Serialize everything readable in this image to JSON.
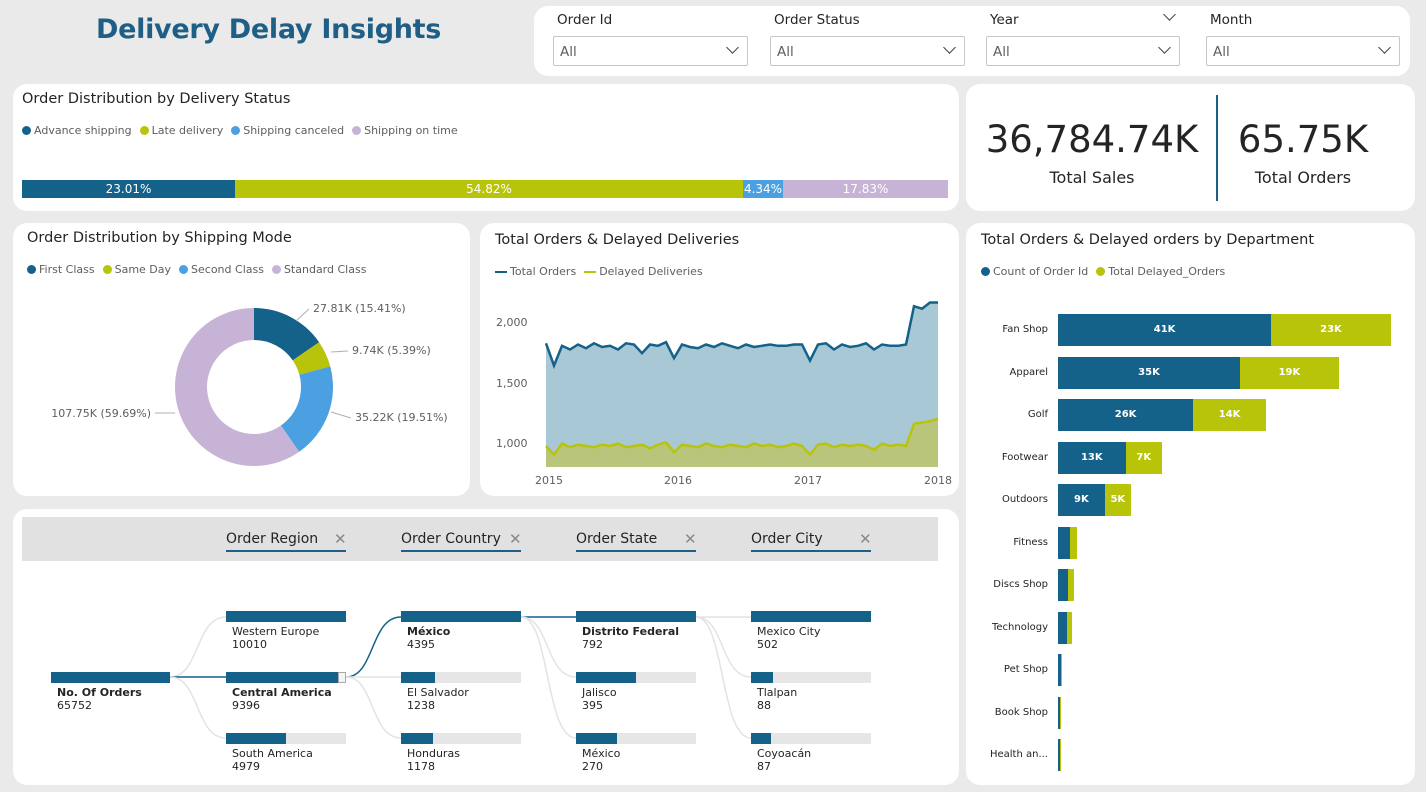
{
  "app": {
    "title": "Delivery Delay Insights"
  },
  "colors": {
    "navy": "#146189",
    "lime": "#b8c40a",
    "sky": "#4aa0e0",
    "lilac": "#c7b3d6",
    "area": "#a8c8d6",
    "area_lime": "#b8c57a"
  },
  "filters": [
    {
      "label": "Order Id",
      "value": "All"
    },
    {
      "label": "Order Status",
      "value": "All"
    },
    {
      "label": "Year",
      "value": "All"
    },
    {
      "label": "Month",
      "value": "All"
    }
  ],
  "delivery_status": {
    "title": "Order Distribution by Delivery Status",
    "legend": [
      "Advance shipping",
      "Late delivery",
      "Shipping canceled",
      "Shipping on time"
    ],
    "segments": [
      {
        "label": "23.01%",
        "value": 23.01
      },
      {
        "label": "54.82%",
        "value": 54.82
      },
      {
        "label": "4.34%",
        "value": 4.34
      },
      {
        "label": "17.83%",
        "value": 17.83
      }
    ]
  },
  "kpis": {
    "sales_value": "36,784.74K",
    "sales_label": "Total Sales",
    "orders_value": "65.75K",
    "orders_label": "Total Orders"
  },
  "shipping_mode": {
    "title": "Order Distribution by Shipping Mode",
    "legend": [
      "First Class",
      "Same Day",
      "Second Class",
      "Standard Class"
    ],
    "slices": [
      {
        "label": "27.81K (15.41%)",
        "value": 15.41
      },
      {
        "label": "9.74K (5.39%)",
        "value": 5.39
      },
      {
        "label": "35.22K (19.51%)",
        "value": 19.51
      },
      {
        "label": "107.75K (59.69%)",
        "value": 59.69
      }
    ]
  },
  "trend": {
    "title": "Total Orders & Delayed Deliveries",
    "legend": [
      "Total Orders",
      "Delayed Deliveries"
    ],
    "y_ticks": [
      "2,000",
      "1,500",
      "1,000"
    ],
    "x_ticks": [
      "2015",
      "2016",
      "2017",
      "2018"
    ]
  },
  "department": {
    "title": "Total Orders & Delayed orders by Department",
    "legend": [
      "Count of Order Id",
      "Total Delayed_Orders"
    ],
    "rows": [
      {
        "name": "Fan Shop",
        "orders": 41,
        "delayed": 23,
        "orders_label": "41K",
        "delayed_label": "23K"
      },
      {
        "name": "Apparel",
        "orders": 35,
        "delayed": 19,
        "orders_label": "35K",
        "delayed_label": "19K"
      },
      {
        "name": "Golf",
        "orders": 26,
        "delayed": 14,
        "orders_label": "26K",
        "delayed_label": "14K"
      },
      {
        "name": "Footwear",
        "orders": 13,
        "delayed": 7,
        "orders_label": "13K",
        "delayed_label": "7K"
      },
      {
        "name": "Outdoors",
        "orders": 9,
        "delayed": 5,
        "orders_label": "9K",
        "delayed_label": "5K"
      },
      {
        "name": "Fitness",
        "orders": 2.4,
        "delayed": 1.3,
        "orders_label": "",
        "delayed_label": ""
      },
      {
        "name": "Discs Shop",
        "orders": 2.0,
        "delayed": 1.1,
        "orders_label": "",
        "delayed_label": ""
      },
      {
        "name": "Technology",
        "orders": 1.7,
        "delayed": 1.0,
        "orders_label": "",
        "delayed_label": ""
      },
      {
        "name": "Pet Shop",
        "orders": 0.5,
        "delayed": 0.3,
        "orders_label": "",
        "delayed_label": ""
      },
      {
        "name": "Book Shop",
        "orders": 0.4,
        "delayed": 0.2,
        "orders_label": "",
        "delayed_label": ""
      },
      {
        "name": "Health an...",
        "orders": 0.4,
        "delayed": 0.2,
        "orders_label": "",
        "delayed_label": ""
      }
    ]
  },
  "decomp": {
    "columns": [
      "Order Region",
      "Order Country",
      "Order State",
      "Order City"
    ],
    "root": {
      "name": "No. Of Orders",
      "value": "65752"
    },
    "levels": [
      [
        {
          "name": "Western Europe",
          "value": "10010",
          "fill": 1.0
        },
        {
          "name": "Central America",
          "value": "9396",
          "fill": 0.94
        },
        {
          "name": "South America",
          "value": "4979",
          "fill": 0.5
        }
      ],
      [
        {
          "name": "México",
          "value": "4395",
          "fill": 1.0
        },
        {
          "name": "El Salvador",
          "value": "1238",
          "fill": 0.28
        },
        {
          "name": "Honduras",
          "value": "1178",
          "fill": 0.27
        }
      ],
      [
        {
          "name": "Distrito Federal",
          "value": "792",
          "fill": 1.0
        },
        {
          "name": "Jalisco",
          "value": "395",
          "fill": 0.5
        },
        {
          "name": "México",
          "value": "270",
          "fill": 0.34
        }
      ],
      [
        {
          "name": "Mexico City",
          "value": "502",
          "fill": 1.0
        },
        {
          "name": "Tlalpan",
          "value": "88",
          "fill": 0.18
        },
        {
          "name": "Coyoacán",
          "value": "87",
          "fill": 0.17
        }
      ]
    ]
  },
  "chart_data": [
    {
      "type": "bar",
      "title": "Order Distribution by Delivery Status",
      "categories": [
        "Advance shipping",
        "Late delivery",
        "Shipping canceled",
        "Shipping on time"
      ],
      "values": [
        23.01,
        54.82,
        4.34,
        17.83
      ]
    },
    {
      "type": "pie",
      "title": "Order Distribution by Shipping Mode",
      "categories": [
        "First Class",
        "Same Day",
        "Second Class",
        "Standard Class"
      ],
      "values": [
        27.81,
        9.74,
        35.22,
        107.75
      ]
    },
    {
      "type": "area",
      "title": "Total Orders & Delayed Deliveries",
      "ylim": [
        800,
        2150
      ],
      "series": [
        {
          "name": "Total Orders",
          "values": [
            1800,
            1620,
            1780,
            1750,
            1790,
            1760,
            1800,
            1770,
            1780,
            1750,
            1800,
            1790,
            1720,
            1790,
            1780,
            1810,
            1680,
            1790,
            1770,
            1760,
            1790,
            1770,
            1800,
            1780,
            1760,
            1790,
            1770,
            1780,
            1790,
            1780,
            1780,
            1790,
            1790,
            1660,
            1790,
            1800,
            1750,
            1790,
            1770,
            1780,
            1800,
            1750,
            1790,
            1780,
            1780,
            1790,
            2100,
            2080,
            2130,
            2130
          ]
        },
        {
          "name": "Delayed Deliveries",
          "values": [
            970,
            900,
            990,
            960,
            980,
            970,
            960,
            980,
            970,
            990,
            960,
            970,
            980,
            950,
            980,
            1000,
            920,
            980,
            970,
            960,
            990,
            970,
            960,
            980,
            970,
            960,
            990,
            970,
            980,
            960,
            970,
            990,
            970,
            900,
            980,
            990,
            960,
            980,
            970,
            980,
            970,
            940,
            990,
            970,
            980,
            970,
            1150,
            1160,
            1170,
            1190
          ]
        }
      ],
      "x": [
        "2015",
        "2016",
        "2017",
        "2018"
      ]
    },
    {
      "type": "bar",
      "title": "Total Orders & Delayed orders by Department",
      "categories": [
        "Fan Shop",
        "Apparel",
        "Golf",
        "Footwear",
        "Outdoors",
        "Fitness",
        "Discs Shop",
        "Technology",
        "Pet Shop",
        "Book Shop",
        "Health an..."
      ],
      "series": [
        {
          "name": "Count of Order Id",
          "values": [
            41,
            35,
            26,
            13,
            9,
            2.4,
            2.0,
            1.7,
            0.5,
            0.4,
            0.4
          ]
        },
        {
          "name": "Total Delayed_Orders",
          "values": [
            23,
            19,
            14,
            7,
            5,
            1.3,
            1.1,
            1.0,
            0.3,
            0.2,
            0.2
          ]
        }
      ]
    }
  ]
}
